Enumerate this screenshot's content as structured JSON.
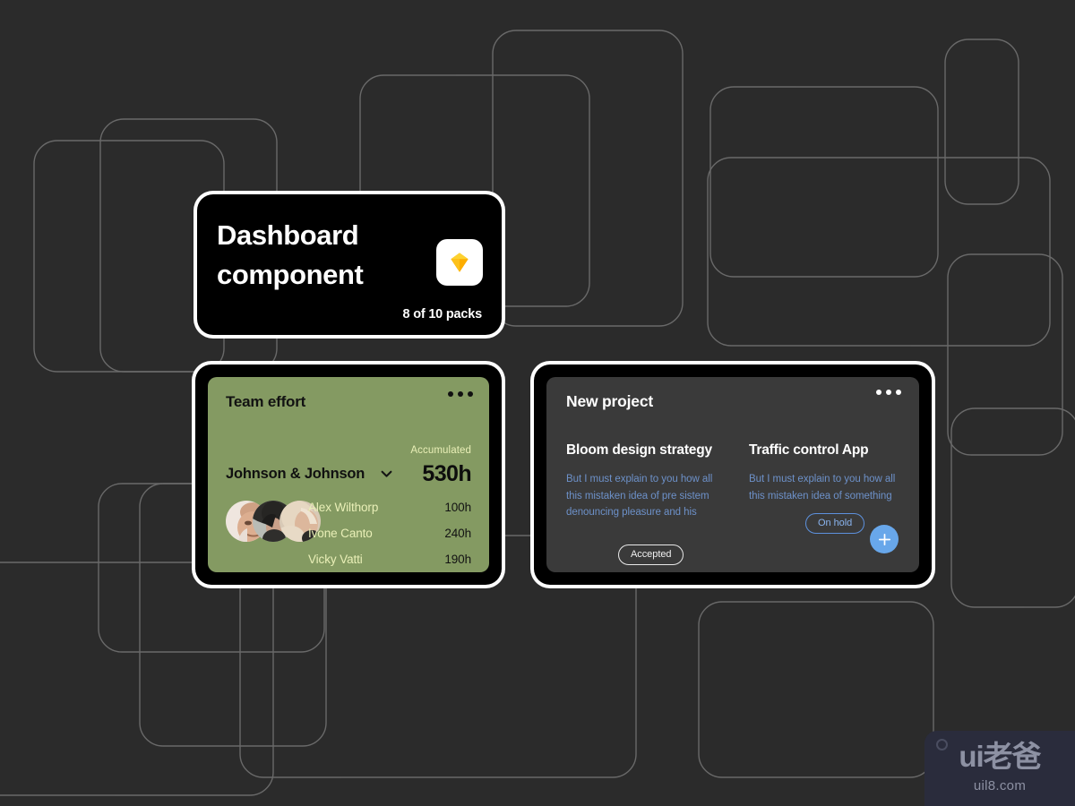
{
  "hero_card": {
    "title_line1": "Dashboard",
    "title_line2": "component",
    "packs_label": "8 of 10 packs",
    "logo_icon": "sketch-diamond-icon"
  },
  "team_card": {
    "title": "Team effort",
    "menu_icon": "more-horizontal-icon",
    "accumulated_label": "Accumulated",
    "company": "Johnson & Johnson",
    "company_caret_icon": "chevron-down-icon",
    "total_hours": "530h",
    "avatars": [
      {
        "name": "avatar-1"
      },
      {
        "name": "avatar-2"
      },
      {
        "name": "avatar-3"
      }
    ],
    "members": [
      {
        "name": "Alex Wilthorp",
        "hours": "100h"
      },
      {
        "name": "Ivone Canto",
        "hours": "240h"
      },
      {
        "name": "Vicky Vatti",
        "hours": "190h"
      }
    ],
    "colors": {
      "card_bg": "#849a62",
      "name_text": "#e9efb7",
      "value_text": "#121212"
    }
  },
  "project_card": {
    "title": "New project",
    "menu_icon": "more-horizontal-icon",
    "items": [
      {
        "title": "Bloom design strategy",
        "description": "But I must explain to you how all this mistaken idea of pre sistem denouncing pleasure and his",
        "status": "Accepted",
        "status_kind": "accepted"
      },
      {
        "title": "Traffic control App",
        "description": "But I must explain to you how all this mistaken idea of something",
        "status": "On hold",
        "status_kind": "onhold"
      }
    ],
    "add_button_icon": "plus-icon",
    "colors": {
      "card_bg": "#3a3a3a",
      "desc_text": "#6d91c9",
      "accent": "#68a7ea"
    }
  },
  "watermark": {
    "logo": "ui老爸",
    "url": "uil8.com"
  },
  "canvas": {
    "background_color": "#2b2b2b",
    "outline_color": "#8f8f8f"
  }
}
